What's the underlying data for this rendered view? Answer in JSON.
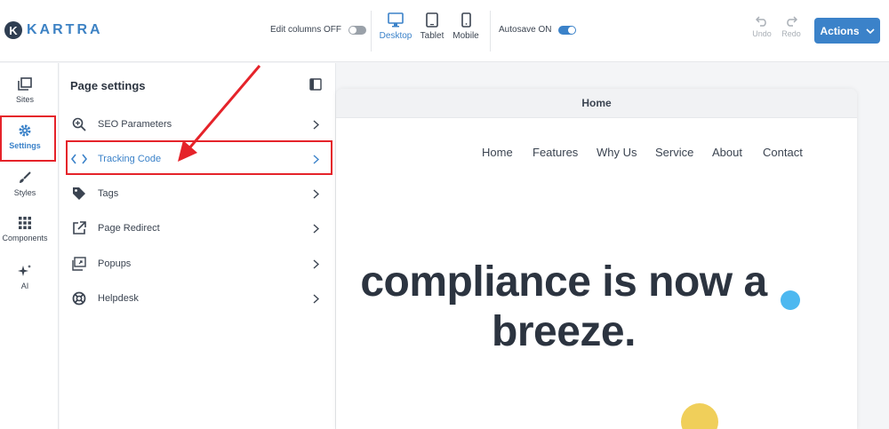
{
  "brand": {
    "logo_letter": "K",
    "name": "KARTRA"
  },
  "toolbar": {
    "edit_columns_label": "Edit columns OFF",
    "devices": [
      {
        "label": "Desktop",
        "active": true
      },
      {
        "label": "Tablet",
        "active": false
      },
      {
        "label": "Mobile",
        "active": false
      }
    ],
    "autosave_label": "Autosave ON",
    "undo_label": "Undo",
    "redo_label": "Redo",
    "actions_label": "Actions"
  },
  "rail": {
    "items": [
      {
        "label": "Sites",
        "icon": "sites-icon"
      },
      {
        "label": "Settings",
        "icon": "gear-icon"
      },
      {
        "label": "Styles",
        "icon": "brush-icon"
      },
      {
        "label": "Components",
        "icon": "grid-icon"
      },
      {
        "label": "AI",
        "icon": "sparkle-icon"
      }
    ]
  },
  "panel": {
    "title": "Page settings",
    "items": [
      {
        "label": "SEO Parameters",
        "icon": "search-icon"
      },
      {
        "label": "Tracking Code",
        "icon": "code-icon"
      },
      {
        "label": "Tags",
        "icon": "tag-icon"
      },
      {
        "label": "Page Redirect",
        "icon": "external-link-icon"
      },
      {
        "label": "Popups",
        "icon": "popup-icon"
      },
      {
        "label": "Helpdesk",
        "icon": "lifebuoy-icon"
      }
    ]
  },
  "preview": {
    "tab_label": "Home",
    "nav": [
      "Home",
      "Features",
      "Why Us",
      "Service",
      "About",
      "Contact"
    ],
    "headline_line1": "compliance is now a",
    "headline_line2": "breeze."
  },
  "colors": {
    "accent": "#3b82c9",
    "highlight": "#e5232a",
    "dot": "#4db8f0",
    "yellow": "#f0cf5a"
  }
}
